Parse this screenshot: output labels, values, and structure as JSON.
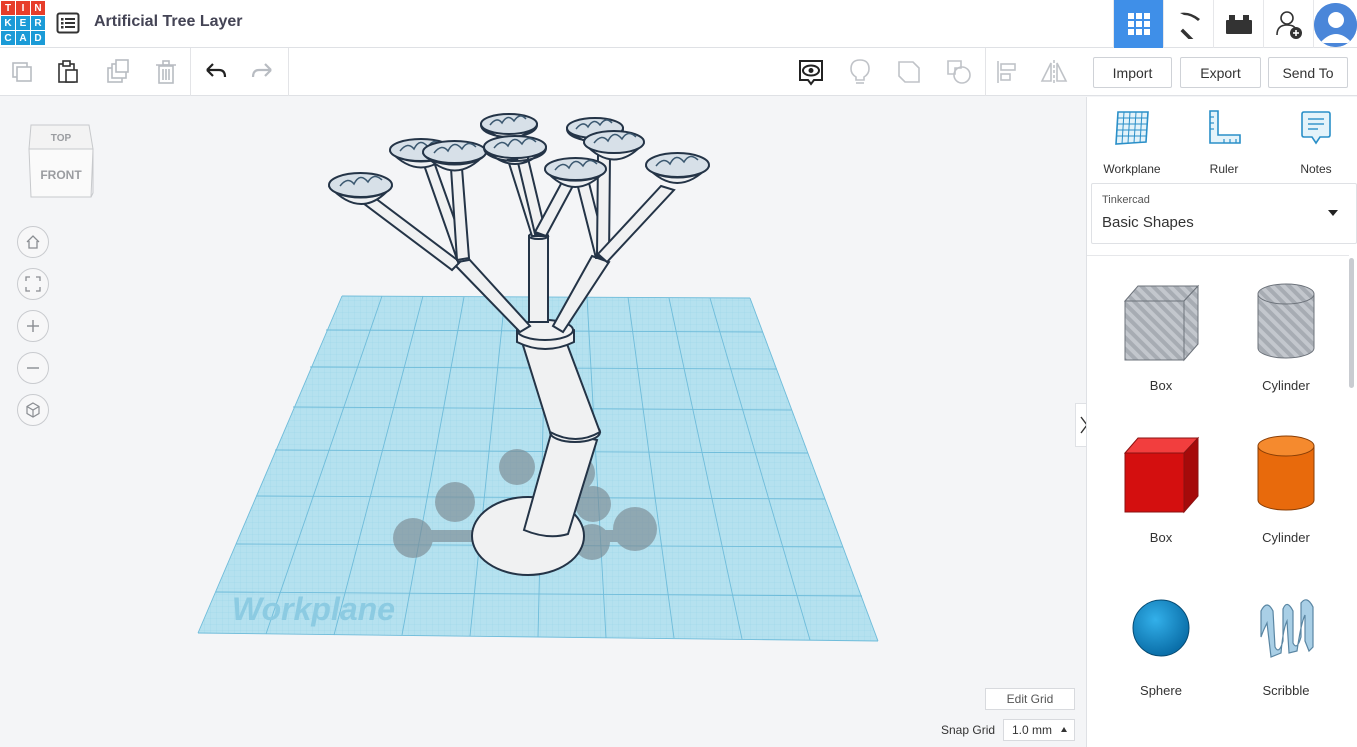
{
  "app": {
    "logo_letters": [
      "T",
      "I",
      "N",
      "K",
      "E",
      "R",
      "C",
      "A",
      "D"
    ],
    "logo_colors": [
      "#e73d2a",
      "#e73d2a",
      "#e73d2a",
      "#1b9bd7",
      "#1b9bd7",
      "#1b9bd7",
      "#1b9bd7",
      "#1b9bd7",
      "#1b9bd7"
    ],
    "title": "Artificial Tree Layer",
    "accent": "#3f8fe8"
  },
  "topbar_icons": [
    "grid-view-icon",
    "pickaxe-icon",
    "bricks-icon",
    "add-user-icon",
    "user-avatar"
  ],
  "toolbar": {
    "left_tools": [
      "copy-icon",
      "paste-icon",
      "duplicate-icon",
      "delete-icon",
      "undo-icon",
      "redo-icon"
    ],
    "right_tools": [
      "show-all-icon",
      "lightbulb-icon",
      "group-icon",
      "ungroup-icon",
      "align-icon",
      "mirror-icon"
    ],
    "import_label": "Import",
    "export_label": "Export",
    "send_label": "Send To"
  },
  "viewcube": {
    "top_label": "TOP",
    "front_label": "FRONT"
  },
  "nav_controls": [
    "home-view-icon",
    "fit-all-icon",
    "zoom-in-icon",
    "zoom-out-icon",
    "ortho-view-icon"
  ],
  "workplane_label": "Workplane",
  "edit_grid_label": "Edit Grid",
  "snap_grid": {
    "label": "Snap Grid",
    "value": "1.0 mm"
  },
  "panel": {
    "tools": [
      {
        "label": "Workplane",
        "icon": "workplane-icon"
      },
      {
        "label": "Ruler",
        "icon": "ruler-icon"
      },
      {
        "label": "Notes",
        "icon": "notes-icon"
      }
    ],
    "library": {
      "provider": "Tinkercad",
      "name": "Basic Shapes"
    },
    "shapes": [
      {
        "name": "Box"
      },
      {
        "name": "Cylinder"
      },
      {
        "name": "Box"
      },
      {
        "name": "Cylinder"
      },
      {
        "name": "Sphere"
      },
      {
        "name": "Scribble"
      }
    ]
  }
}
